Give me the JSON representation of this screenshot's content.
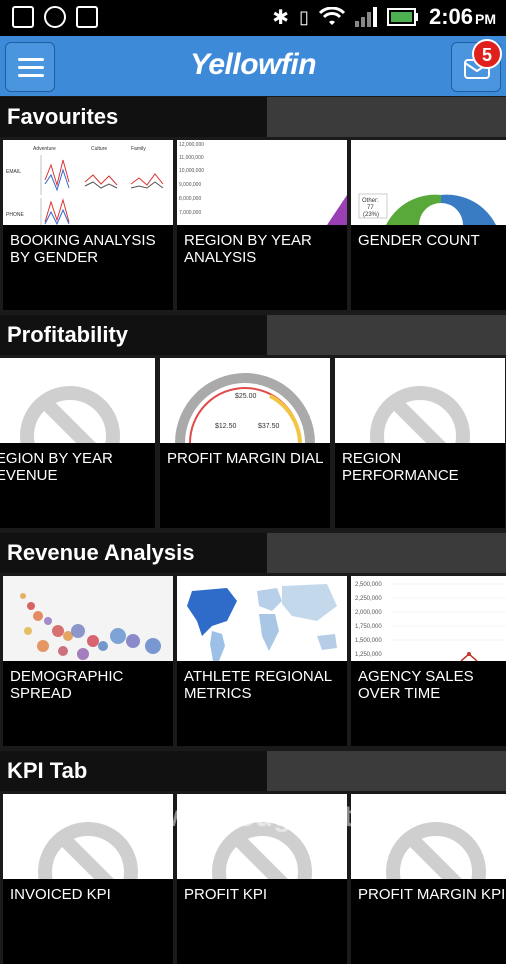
{
  "status_bar": {
    "time": "2:06",
    "ampm": "PM"
  },
  "app": {
    "logo": "Yellowfin",
    "notifications": "5"
  },
  "sections": [
    {
      "title": "Favourites",
      "tiles": [
        "BOOKING ANALYSIS BY GENDER",
        "REGION BY YEAR ANALYSIS",
        "GENDER COUNT"
      ]
    },
    {
      "title": "Profitability",
      "tiles": [
        "REGION BY YEAR REVENUE",
        "PROFIT MARGIN DIAL",
        "REGION PERFORMANCE"
      ]
    },
    {
      "title": "Revenue Analysis",
      "tiles": [
        "DEMOGRAPHIC SPREAD",
        "ATHLETE REGIONAL METRICS",
        "AGENCY SALES OVER TIME"
      ]
    },
    {
      "title": "KPI Tab",
      "tiles": [
        "INVOICED KPI",
        "PROFIT KPI",
        "PROFIT MARGIN KPI"
      ]
    }
  ],
  "thumbs": {
    "booking": {
      "col1": "Adventure",
      "col2": "Culture",
      "col3": "Family",
      "row1": "EMAIL",
      "row2": "PHONE"
    },
    "region_axis": [
      "12,000,000",
      "11,000,000",
      "10,000,000",
      "9,000,000",
      "8,000,000",
      "7,000,000"
    ],
    "gender": {
      "label": "Other:",
      "value": "77",
      "pct": "(23%)"
    },
    "dial": {
      "top": "$25.00",
      "left": "$12.50",
      "right": "$37.50"
    },
    "agency_axis": [
      "2,500,000",
      "2,250,000",
      "2,000,000",
      "1,750,000",
      "1,500,000",
      "1,250,000"
    ]
  },
  "watermark": {
    "brand": "SoftwareSuggest",
    "suffix": ".com"
  }
}
